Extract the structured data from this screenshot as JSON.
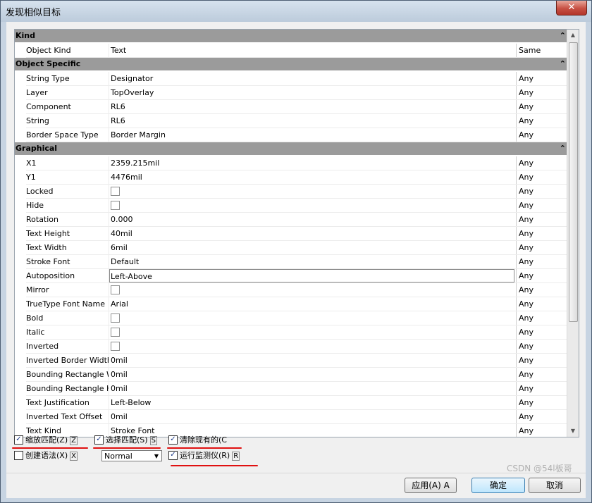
{
  "window": {
    "title": "发现相似目标",
    "close_label": "✕"
  },
  "categories": {
    "kind": "Kind",
    "object_specific": "Object Specific",
    "graphical": "Graphical"
  },
  "rows": {
    "kind": [
      {
        "name": "Object Kind",
        "value": "Text",
        "match": "Same"
      }
    ],
    "object_specific": [
      {
        "name": "String Type",
        "value": "Designator",
        "match": "Any"
      },
      {
        "name": "Layer",
        "value": "TopOverlay",
        "match": "Any"
      },
      {
        "name": "Component",
        "value": "RL6",
        "match": "Any"
      },
      {
        "name": "String",
        "value": "RL6",
        "match": "Any"
      },
      {
        "name": "Border Space Type",
        "value": "Border Margin",
        "match": "Any"
      }
    ],
    "graphical": [
      {
        "name": "X1",
        "value": "2359.215mil",
        "match": "Any"
      },
      {
        "name": "Y1",
        "value": "4476mil",
        "match": "Any"
      },
      {
        "name": "Locked",
        "value": "",
        "checkbox": true,
        "match": "Any"
      },
      {
        "name": "Hide",
        "value": "",
        "checkbox": true,
        "match": "Any"
      },
      {
        "name": "Rotation",
        "value": "0.000",
        "match": "Any"
      },
      {
        "name": "Text Height",
        "value": "40mil",
        "match": "Any"
      },
      {
        "name": "Text Width",
        "value": "6mil",
        "match": "Any"
      },
      {
        "name": "Stroke Font",
        "value": "Default",
        "match": "Any"
      },
      {
        "name": "Autoposition",
        "value": "Left-Above",
        "match": "Any",
        "selected": true
      },
      {
        "name": "Mirror",
        "value": "",
        "checkbox": true,
        "match": "Any"
      },
      {
        "name": "TrueType Font Name",
        "value": "Arial",
        "match": "Any"
      },
      {
        "name": "Bold",
        "value": "",
        "checkbox": true,
        "match": "Any"
      },
      {
        "name": "Italic",
        "value": "",
        "checkbox": true,
        "match": "Any"
      },
      {
        "name": "Inverted",
        "value": "",
        "checkbox": true,
        "match": "Any"
      },
      {
        "name": "Inverted Border Width",
        "value": "0mil",
        "match": "Any"
      },
      {
        "name": "Bounding Rectangle W",
        "value": "0mil",
        "match": "Any"
      },
      {
        "name": "Bounding Rectangle H",
        "value": "0mil",
        "match": "Any"
      },
      {
        "name": "Text Justification",
        "value": "Left-Below",
        "match": "Any"
      },
      {
        "name": "Inverted Text Offset",
        "value": "0mil",
        "match": "Any"
      },
      {
        "name": "Text Kind",
        "value": "Stroke Font",
        "match": "Any"
      }
    ]
  },
  "options": {
    "zoom_matching": {
      "label": "缩放匹配(Z)",
      "hotkey": "Z",
      "checked": true
    },
    "select_matching": {
      "label": "选择匹配(S)",
      "hotkey": "S",
      "checked": true
    },
    "clear_existing": {
      "label": "清除现有的(C",
      "checked": true
    },
    "create_expression": {
      "label": "创建语法(X)",
      "hotkey": "X",
      "checked": false
    },
    "mask_mode": {
      "value": "Normal"
    },
    "run_inspector": {
      "label": "运行监测仪(R)",
      "hotkey": "R",
      "checked": true
    }
  },
  "buttons": {
    "apply": "应用(A) A",
    "ok": "确定",
    "cancel": "取消"
  },
  "watermark": "CSDN @54l板哥",
  "colors": {
    "annotation_red": "#e01010",
    "category_header": "#9b9b9b"
  }
}
